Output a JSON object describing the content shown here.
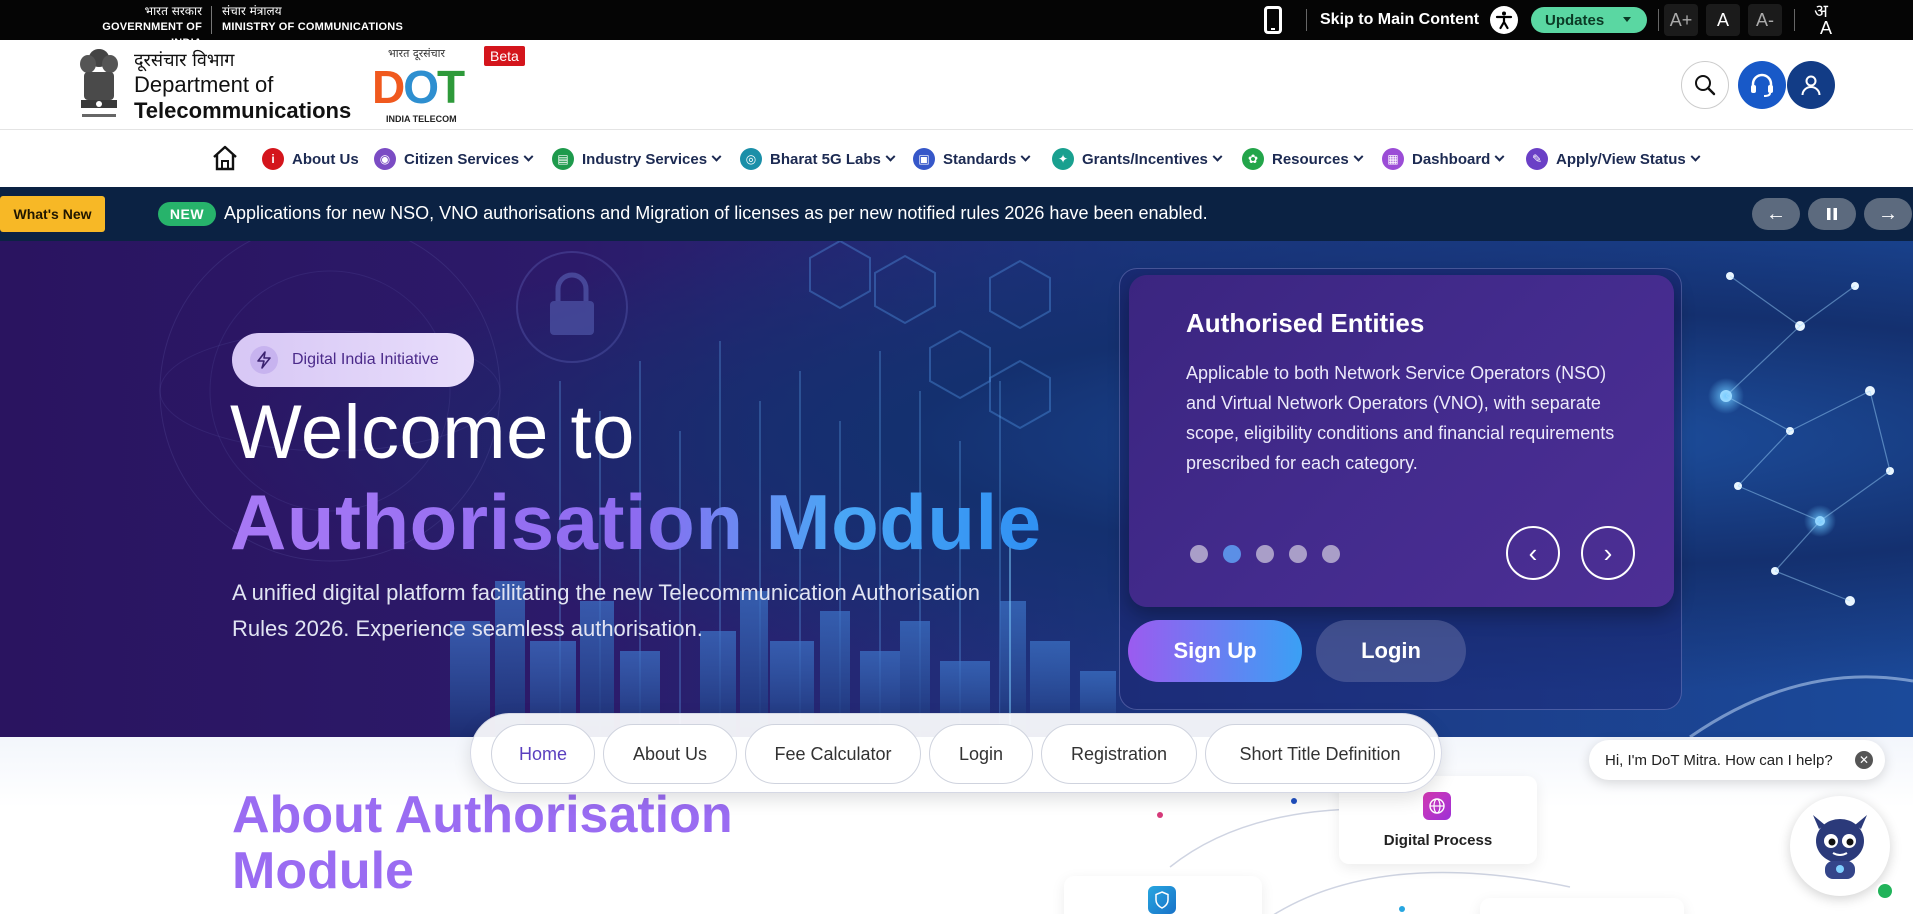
{
  "gov_bar": {
    "left_hi": "भारत सरकार",
    "left_en": "GOVERNMENT OF INDIA",
    "right_hi": "संचार मंत्रालय",
    "right_en": "MINISTRY OF COMMUNICATIONS",
    "skip_link": "Skip to Main Content",
    "updates_label": "Updates",
    "font_increase": "A+",
    "font_normal": "A",
    "font_decrease": "A-",
    "lang_top": "अ",
    "lang_bottom": "A"
  },
  "header": {
    "dept_hi": "दूरसंचार विभाग",
    "dept_en_1": "Department of",
    "dept_en_2": "Telecommunications",
    "logo_hi": "भारत दूरसंचार",
    "logo_d": "D",
    "logo_o": "O",
    "logo_t": "T",
    "logo_en": "INDIA TELECOM",
    "beta": "Beta"
  },
  "nav": {
    "items": [
      {
        "label": "About Us",
        "color": "#d4151c"
      },
      {
        "label": "Citizen Services",
        "color": "#7b4cc4"
      },
      {
        "label": "Industry Services",
        "color": "#1e9a4c"
      },
      {
        "label": "Bharat 5G Labs",
        "color": "#1a8fa8"
      },
      {
        "label": "Standards",
        "color": "#3657c9"
      },
      {
        "label": "Grants/Incentives",
        "color": "#19a08f"
      },
      {
        "label": "Resources",
        "color": "#23a54a"
      },
      {
        "label": "Dashboard",
        "color": "#9b4cd6"
      },
      {
        "label": "Apply/View Status",
        "color": "#6a3fc6"
      }
    ]
  },
  "ticker": {
    "whats_new": "What's New",
    "badge": "NEW",
    "text": "Applications for new NSO, VNO authorisations and Migration of licenses as per new notified rules 2026 have been enabled."
  },
  "hero": {
    "badge": "Digital India Initiative",
    "title_1": "Welcome to",
    "title_2": "Authorisation Module",
    "subtitle": "A unified digital platform facilitating the new Telecommunication Authorisation Rules 2026. Experience seamless authorisation.",
    "card": {
      "title": "Authorised Entities",
      "text": "Applicable to both Network Service Operators (NSO) and Virtual Network Operators (VNO), with separate scope, eligibility conditions and financial requirements prescribed for each category.",
      "dot_count": 5,
      "active_dot": 2
    },
    "signup": "Sign Up",
    "login": "Login"
  },
  "quick_links": {
    "items": [
      "Home",
      "About Us",
      "Fee Calculator",
      "Login",
      "Registration",
      "Short Title Definition"
    ],
    "active": "Home"
  },
  "about": {
    "title": "About Authorisation Module",
    "digital_process": "Digital Process"
  },
  "chatbot": {
    "greeting": "Hi, I'm DoT Mitra. How can I help?"
  }
}
